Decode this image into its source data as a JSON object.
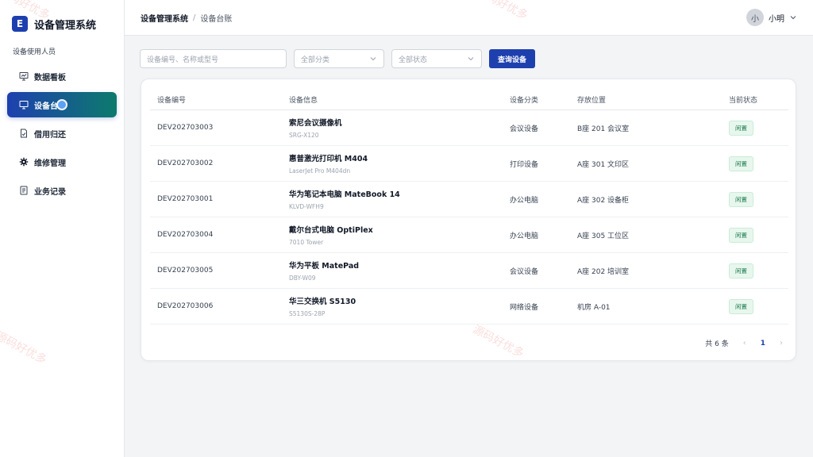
{
  "brand": {
    "logo_letter": "E",
    "title": "设备管理系统"
  },
  "sidebar": {
    "section_label": "设备使用人员",
    "items": [
      {
        "label": "数据看板",
        "icon": "presentation-chart-icon"
      },
      {
        "label": "设备台",
        "icon": "monitor-icon",
        "active": true
      },
      {
        "label": "借用归还",
        "icon": "document-check-icon"
      },
      {
        "label": "维修管理",
        "icon": "gear-icon"
      },
      {
        "label": "业务记录",
        "icon": "document-list-icon"
      }
    ]
  },
  "header": {
    "breadcrumb": {
      "root": "设备管理系统",
      "separator": "/",
      "current": "设备台账"
    },
    "user": {
      "avatar_text": "小",
      "name": "小明"
    }
  },
  "filters": {
    "search_placeholder": "设备编号、名称或型号",
    "category_value": "全部分类",
    "status_value": "全部状态",
    "query_button": "查询设备"
  },
  "table": {
    "columns": [
      "设备编号",
      "设备信息",
      "设备分类",
      "存放位置",
      "当前状态"
    ],
    "rows": [
      {
        "id": "DEV202703003",
        "name": "索尼会议摄像机",
        "model": "SRG-X120",
        "category": "会议设备",
        "location": "B座 201 会议室",
        "status": "闲置"
      },
      {
        "id": "DEV202703002",
        "name": "惠普激光打印机 M404",
        "model": "LaserJet Pro M404dn",
        "category": "打印设备",
        "location": "A座 301 文印区",
        "status": "闲置"
      },
      {
        "id": "DEV202703001",
        "name": "华为笔记本电脑 MateBook 14",
        "model": "KLVD-WFH9",
        "category": "办公电脑",
        "location": "A座 302 设备柜",
        "status": "闲置"
      },
      {
        "id": "DEV202703004",
        "name": "戴尔台式电脑 OptiPlex",
        "model": "7010 Tower",
        "category": "办公电脑",
        "location": "A座 305 工位区",
        "status": "闲置"
      },
      {
        "id": "DEV202703005",
        "name": "华为平板 MatePad",
        "model": "DBY-W09",
        "category": "会议设备",
        "location": "A座 202 培训室",
        "status": "闲置"
      },
      {
        "id": "DEV202703006",
        "name": "华三交换机 S5130",
        "model": "S5130S-28P",
        "category": "网络设备",
        "location": "机房 A-01",
        "status": "闲置"
      }
    ]
  },
  "pagination": {
    "total_text": "共 6 条",
    "prev": "‹",
    "current_page": "1",
    "next": "›"
  },
  "watermark": {
    "text": "源码好优多"
  },
  "colors": {
    "primary": "#1e40af",
    "accent_gradient_end": "#0d7a6c",
    "status_idle_bg": "#e8f7ee",
    "status_idle_text": "#16794a"
  }
}
